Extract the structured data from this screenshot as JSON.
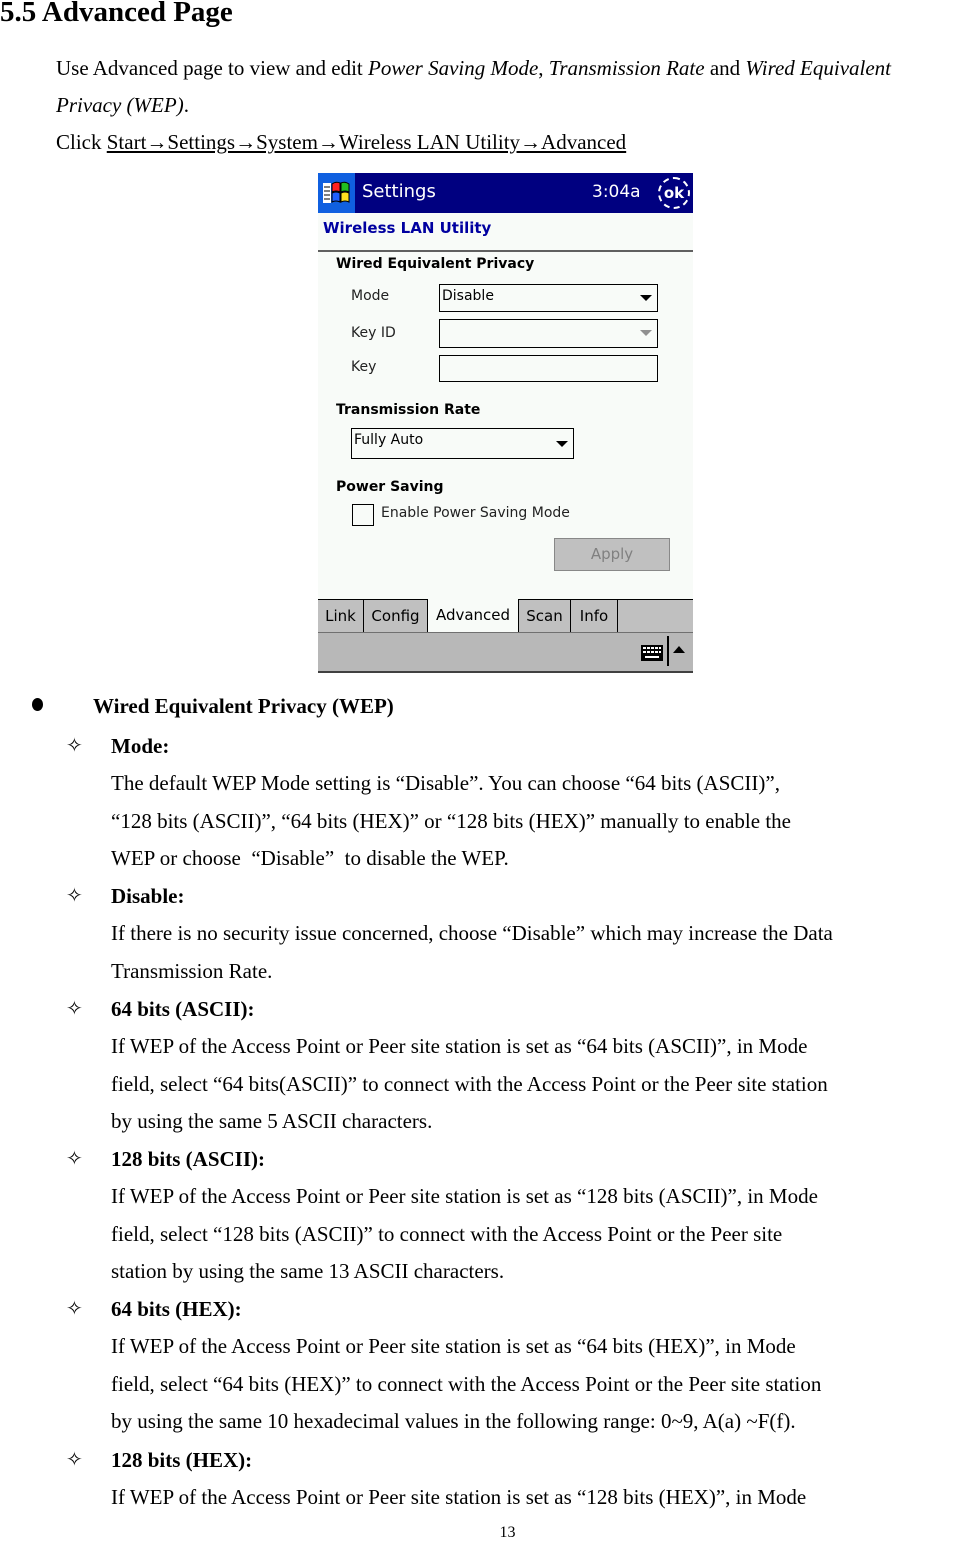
{
  "heading": "5.5 Advanced Page",
  "intro": {
    "prefix": "Use Advanced page to view and edit ",
    "em1": "Power Saving Mode",
    "sep1": ", ",
    "em2": "Transmission Rate",
    "sep2": " and ",
    "em3": "Wired Equivalent Privacy (WEP)",
    "suffix": "."
  },
  "click_line": {
    "prefix": "Click ",
    "path": "Start→Settings→System→Wireless LAN Utility→Advanced"
  },
  "pda": {
    "title": "Settings",
    "clock": "3:04a",
    "ok_label": "ok",
    "app_title": "Wireless LAN Utility",
    "wep_section": "Wired Equivalent Privacy",
    "mode_label": "Mode",
    "mode_value": "Disable",
    "keyid_label": "Key ID",
    "keyid_value": "",
    "key_label": "Key",
    "key_value": "",
    "rate_section": "Transmission Rate",
    "rate_value": "Fully Auto",
    "power_section": "Power Saving",
    "power_checkbox_label": "Enable Power Saving Mode",
    "power_checked": false,
    "apply_label": "Apply",
    "tabs": [
      {
        "label": "Link",
        "active": false
      },
      {
        "label": "Config",
        "active": false
      },
      {
        "label": "Advanced",
        "active": true
      },
      {
        "label": "Scan",
        "active": false
      },
      {
        "label": "Info",
        "active": false
      }
    ],
    "colors": {
      "titlebar": "#000080",
      "start": "#1060e0",
      "app_title": "#0000a0"
    }
  },
  "section": {
    "title": "Wired Equivalent Privacy (WEP)",
    "items": [
      {
        "title": "Mode:",
        "lines": [
          "The default WEP Mode setting is “Disable”. You can choose “64 bits (ASCII)”,",
          "“128 bits (ASCII)”, “64 bits (HEX)” or “128 bits (HEX)” manually to enable the",
          "WEP or choose  “Disable”  to disable the WEP."
        ]
      },
      {
        "title": "Disable:",
        "lines": [
          "If there is no security issue concerned, choose “Disable” which may increase the Data",
          "Transmission Rate."
        ]
      },
      {
        "title": "64 bits (ASCII):",
        "lines": [
          "If WEP of the Access Point or Peer site station is set as “64 bits (ASCII)”, in Mode",
          "field, select “64 bits(ASCII)” to connect with the Access Point or the Peer site station",
          "by using the same 5 ASCII characters."
        ]
      },
      {
        "title": "128 bits (ASCII):",
        "lines": [
          "If WEP of the Access Point or Peer site station is set as “128 bits (ASCII)”, in Mode",
          "field, select “128 bits (ASCII)” to connect with the Access Point or the Peer site",
          "station by using the same 13 ASCII characters."
        ]
      },
      {
        "title": "64 bits (HEX):",
        "lines": [
          "If WEP of the Access Point or Peer site station is set as “64 bits (HEX)”, in Mode",
          "field, select “64 bits (HEX)” to connect with the Access Point or the Peer site station",
          "by using the same 10 hexadecimal values in the following range: 0~9, A(a) ~F(f)."
        ]
      },
      {
        "title": "128 bits (HEX):",
        "lines": [
          "If WEP of the Access Point or Peer site station is set as “128 bits (HEX)”, in Mode"
        ]
      }
    ]
  },
  "page_number": "13"
}
